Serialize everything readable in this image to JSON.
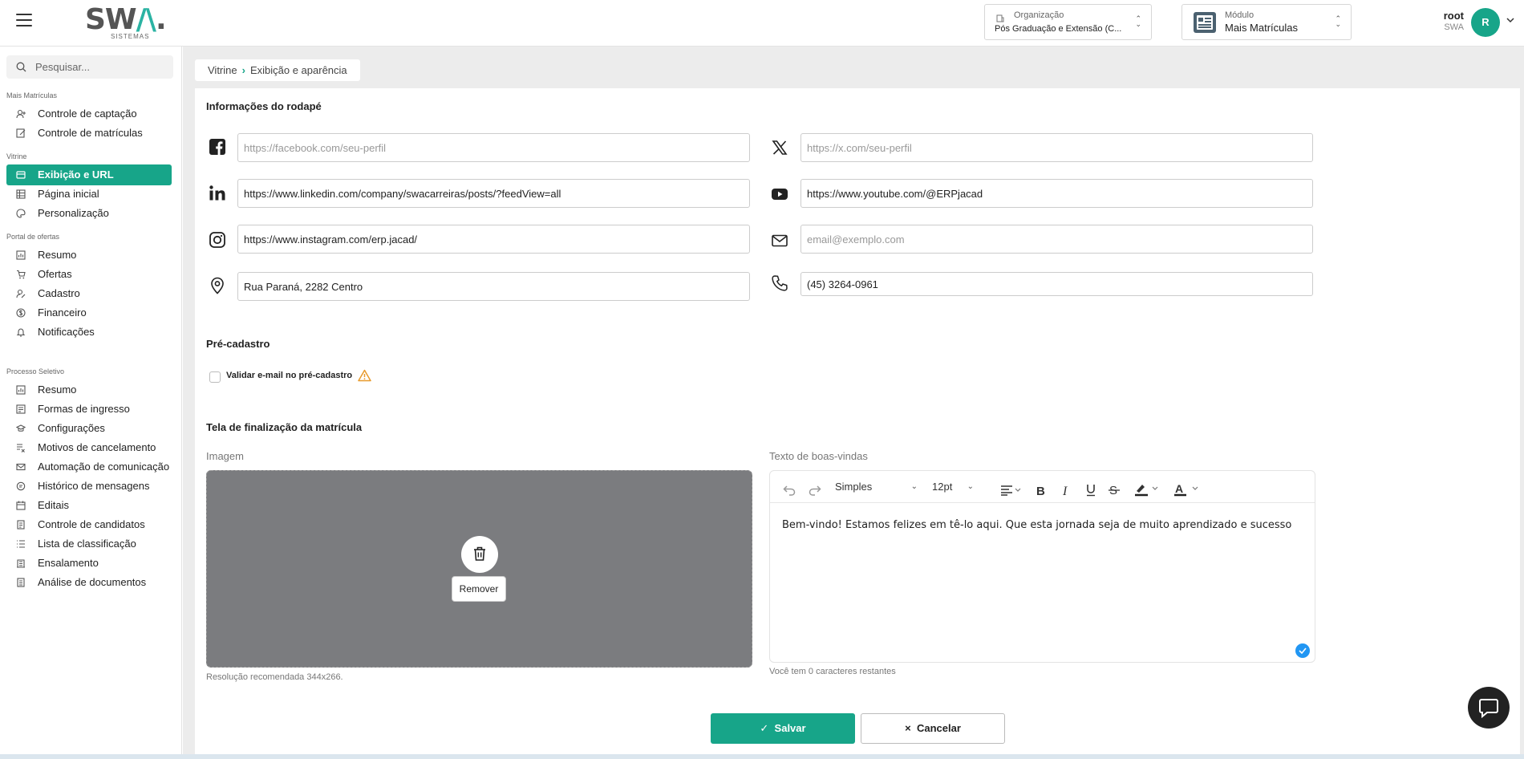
{
  "header": {
    "logo_main": "SW",
    "logo_accent": "/\\",
    "logo_dot": ".",
    "logo_sub": "SISTEMAS",
    "organization_label": "Organização",
    "organization_value": "Pós Graduação e Extensão (C...",
    "module_label": "Módulo",
    "module_value": "Mais Matrículas",
    "user_name": "root",
    "user_org": "SWA",
    "avatar_initial": "R"
  },
  "sidebar": {
    "search_placeholder": "Pesquisar...",
    "sections": [
      {
        "label": "Mais Matrículas",
        "items": [
          {
            "label": "Controle de captação",
            "icon": "user-plus-icon"
          },
          {
            "label": "Controle de matrículas",
            "icon": "edit-doc-icon"
          }
        ]
      },
      {
        "label": "Vitrine",
        "items": [
          {
            "label": "Exibição e URL",
            "icon": "display-icon",
            "active": true
          },
          {
            "label": "Página inicial",
            "icon": "grid-icon"
          },
          {
            "label": "Personalização",
            "icon": "palette-icon"
          }
        ]
      },
      {
        "label": "Portal de ofertas",
        "items": [
          {
            "label": "Resumo",
            "icon": "chart-icon"
          },
          {
            "label": "Ofertas",
            "icon": "cart-icon"
          },
          {
            "label": "Cadastro",
            "icon": "user-edit-icon"
          },
          {
            "label": "Financeiro",
            "icon": "dollar-icon"
          },
          {
            "label": "Notificações",
            "icon": "bell-icon"
          }
        ]
      },
      {
        "label": "Processo Seletivo",
        "items": [
          {
            "label": "Resumo",
            "icon": "chart-icon"
          },
          {
            "label": "Formas de ingresso",
            "icon": "form-icon"
          },
          {
            "label": "Configurações",
            "icon": "cap-icon"
          },
          {
            "label": "Motivos de cancelamento",
            "icon": "list-x-icon"
          },
          {
            "label": "Automação de comunicação",
            "icon": "mail-icon"
          },
          {
            "label": "Histórico de mensagens",
            "icon": "chat-history-icon"
          },
          {
            "label": "Editais",
            "icon": "calendar-icon"
          },
          {
            "label": "Controle de candidatos",
            "icon": "doc-icon"
          },
          {
            "label": "Lista de classificação",
            "icon": "ranking-icon"
          },
          {
            "label": "Ensalamento",
            "icon": "building-icon"
          },
          {
            "label": "Análise de documentos",
            "icon": "doc-check-icon"
          }
        ]
      }
    ]
  },
  "breadcrumb": {
    "root": "Vitrine",
    "current": "Exibição e aparência"
  },
  "footer_info": {
    "title": "Informações do rodapé",
    "facebook": {
      "value": "",
      "placeholder": "https://facebook.com/seu-perfil"
    },
    "x": {
      "value": "",
      "placeholder": "https://x.com/seu-perfil"
    },
    "linkedin": {
      "value": "https://www.linkedin.com/company/swacarreiras/posts/?feedView=all",
      "placeholder": ""
    },
    "youtube": {
      "value": "https://www.youtube.com/@ERPjacad",
      "placeholder": ""
    },
    "instagram": {
      "value": "https://www.instagram.com/erp.jacad/",
      "placeholder": ""
    },
    "email": {
      "value": "",
      "placeholder": "email@exemplo.com"
    },
    "address": {
      "value": "Rua Paraná, 2282 Centro",
      "placeholder": ""
    },
    "phone": {
      "value": "(45) 3264-0961",
      "placeholder": ""
    }
  },
  "pre_registration": {
    "title": "Pré-cadastro",
    "validate_email_label": "Validar e-mail no pré-cadastro",
    "validate_email_checked": false
  },
  "completion_screen": {
    "title": "Tela de finalização da matrícula",
    "image_label": "Imagem",
    "remove_label": "Remover",
    "image_hint": "Resolução recomendada 344x266.",
    "welcome_label": "Texto de boas-vindas",
    "style_select": "Simples",
    "size_select": "12pt",
    "welcome_text": "Bem-vindo! Estamos felizes em tê-lo aqui. Que esta jornada seja de muito aprendizado e sucesso",
    "chars_left": "Você tem 0 caracteres restantes"
  },
  "actions": {
    "save": "Salvar",
    "cancel": "Cancelar"
  },
  "colors": {
    "accent": "#17a589",
    "image_placeholder": "#7b7c7f",
    "warning": "#e89a2c",
    "badge": "#2196f3"
  }
}
